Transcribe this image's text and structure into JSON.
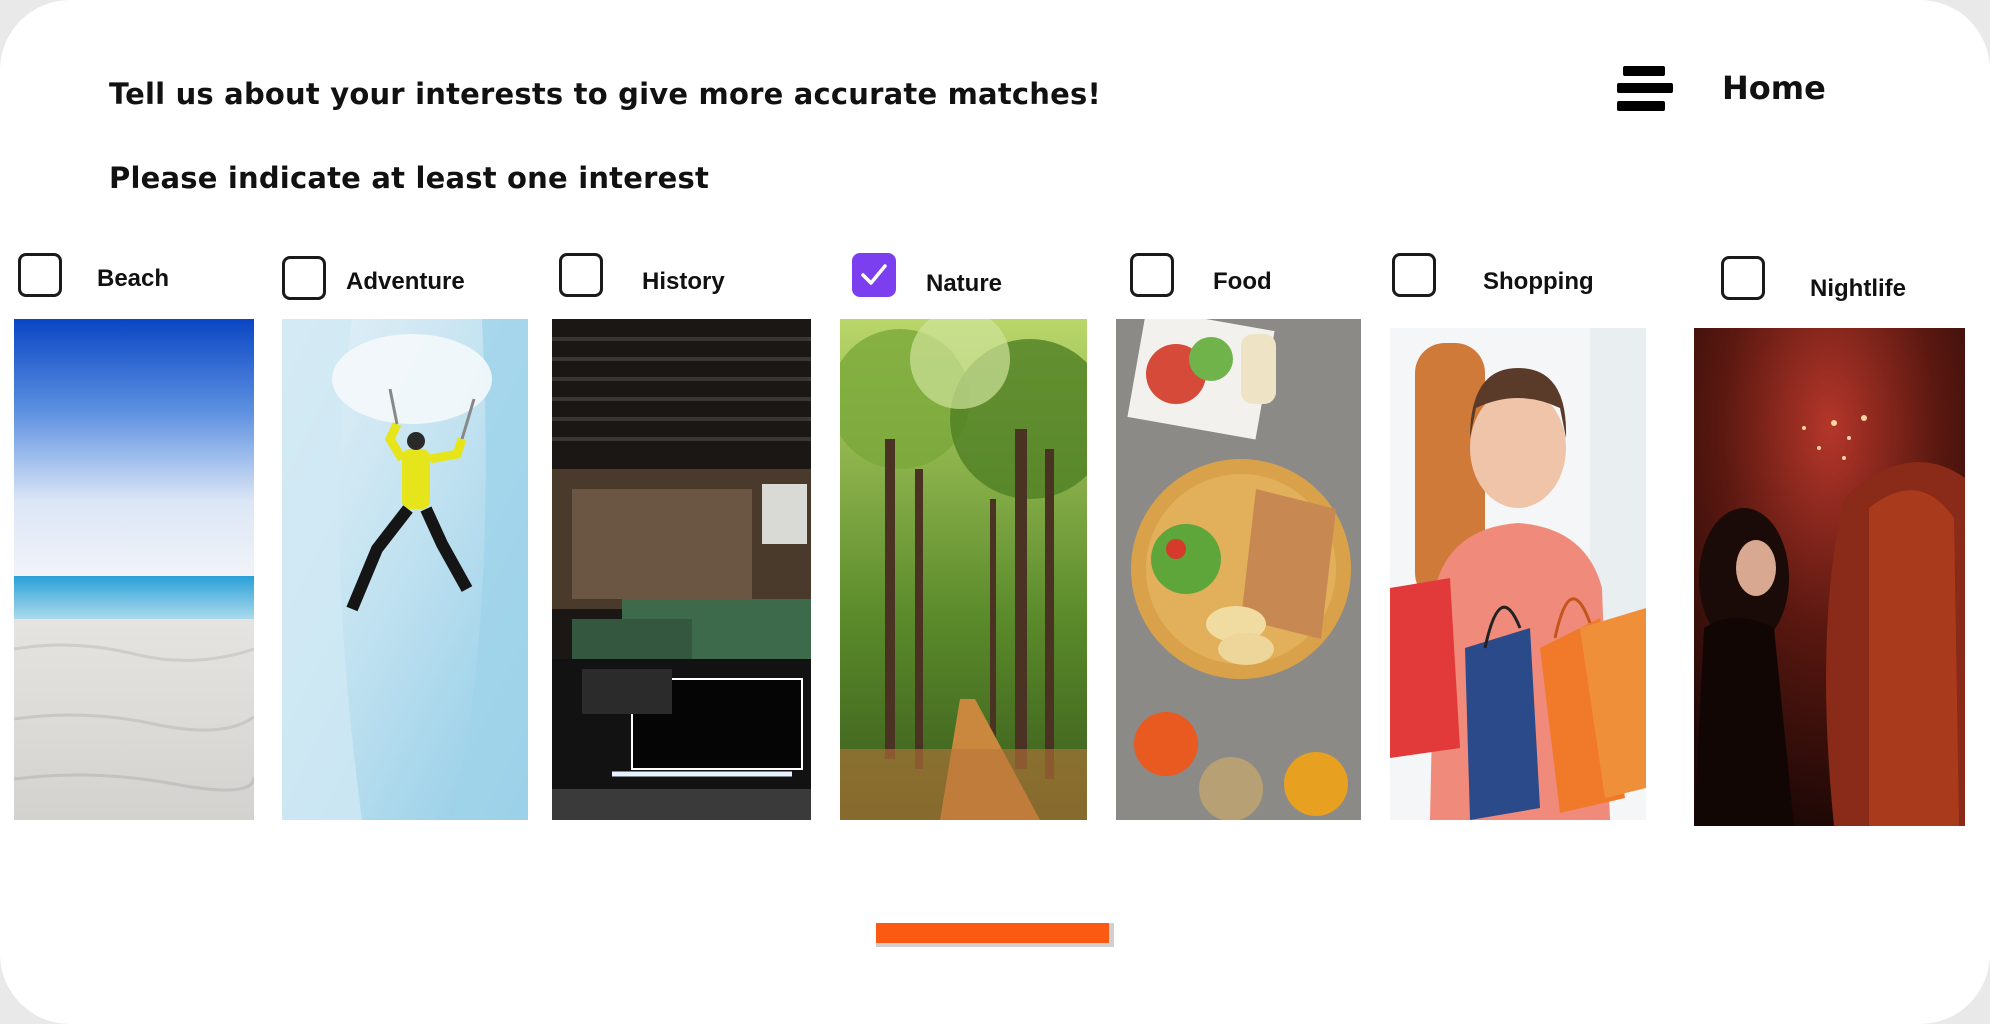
{
  "header": {
    "title": "Tell us about your interests to give more accurate matches!",
    "subtitle": "Please indicate at least one interest",
    "home_label": "Home",
    "menu_icon": "menu-icon"
  },
  "interests": [
    {
      "label": "Beach",
      "checked": false
    },
    {
      "label": "Adventure",
      "checked": false
    },
    {
      "label": "History",
      "checked": false
    },
    {
      "label": "Nature",
      "checked": true
    },
    {
      "label": "Food",
      "checked": false
    },
    {
      "label": "Shopping",
      "checked": false
    },
    {
      "label": "Nightlife",
      "checked": false
    }
  ],
  "colors": {
    "checkbox_checked": "#7b3ff0",
    "progress_fill": "#fb5a13"
  },
  "progress": {
    "fraction": 0.98
  }
}
